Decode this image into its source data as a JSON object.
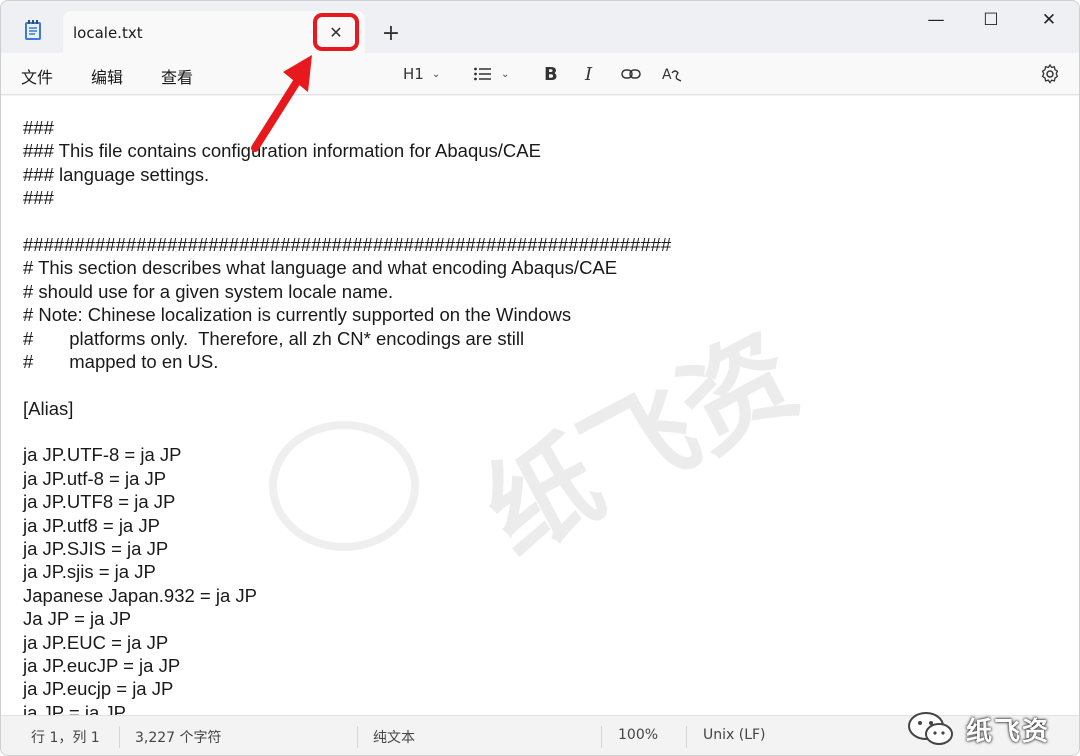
{
  "window": {
    "tab_title": "locale.txt",
    "close_tab_glyph": "✕",
    "new_tab_glyph": "+",
    "minimize_glyph": "—",
    "maximize_glyph": "☐",
    "close_glyph": "✕"
  },
  "menu": {
    "file": "文件",
    "edit": "编辑",
    "view": "查看"
  },
  "toolbar": {
    "heading": "H1",
    "bold": "B",
    "italic": "I",
    "chevron": "⌄",
    "icons": [
      "list-icon",
      "link-icon",
      "spellcheck-icon",
      "settings-icon"
    ]
  },
  "document": {
    "lines": [
      "###",
      "### This file contains configuration information for Abaqus/CAE",
      "### language settings.",
      "###",
      "",
      "###############################################################",
      "# This section describes what language and what encoding Abaqus/CAE",
      "# should use for a given system locale name.",
      "# Note: Chinese localization is currently supported on the Windows",
      "#       platforms only.  Therefore, all zh CN* encodings are still",
      "#       mapped to en US.",
      "",
      "[Alias]",
      "",
      "ja JP.UTF-8 = ja JP",
      "ja JP.utf-8 = ja JP",
      "ja JP.UTF8 = ja JP",
      "ja JP.utf8 = ja JP",
      "ja JP.SJIS = ja JP",
      "ja JP.sjis = ja JP",
      "Japanese Japan.932 = ja JP",
      "Ja JP = ja JP",
      "ja JP.EUC = ja JP",
      "ja JP.eucJP = ja JP",
      "ja JP.eucjp = ja JP",
      "ja JP = ja JP"
    ]
  },
  "status": {
    "position": "行 1，列 1",
    "char_count": "3,227 个字符",
    "format": "纯文本",
    "zoom": "100%",
    "line_ending": "Unix (LF)"
  },
  "watermark": {
    "brand": "纸飞资"
  },
  "colors": {
    "highlight": "#e8191c",
    "arrow": "#e8191c"
  }
}
